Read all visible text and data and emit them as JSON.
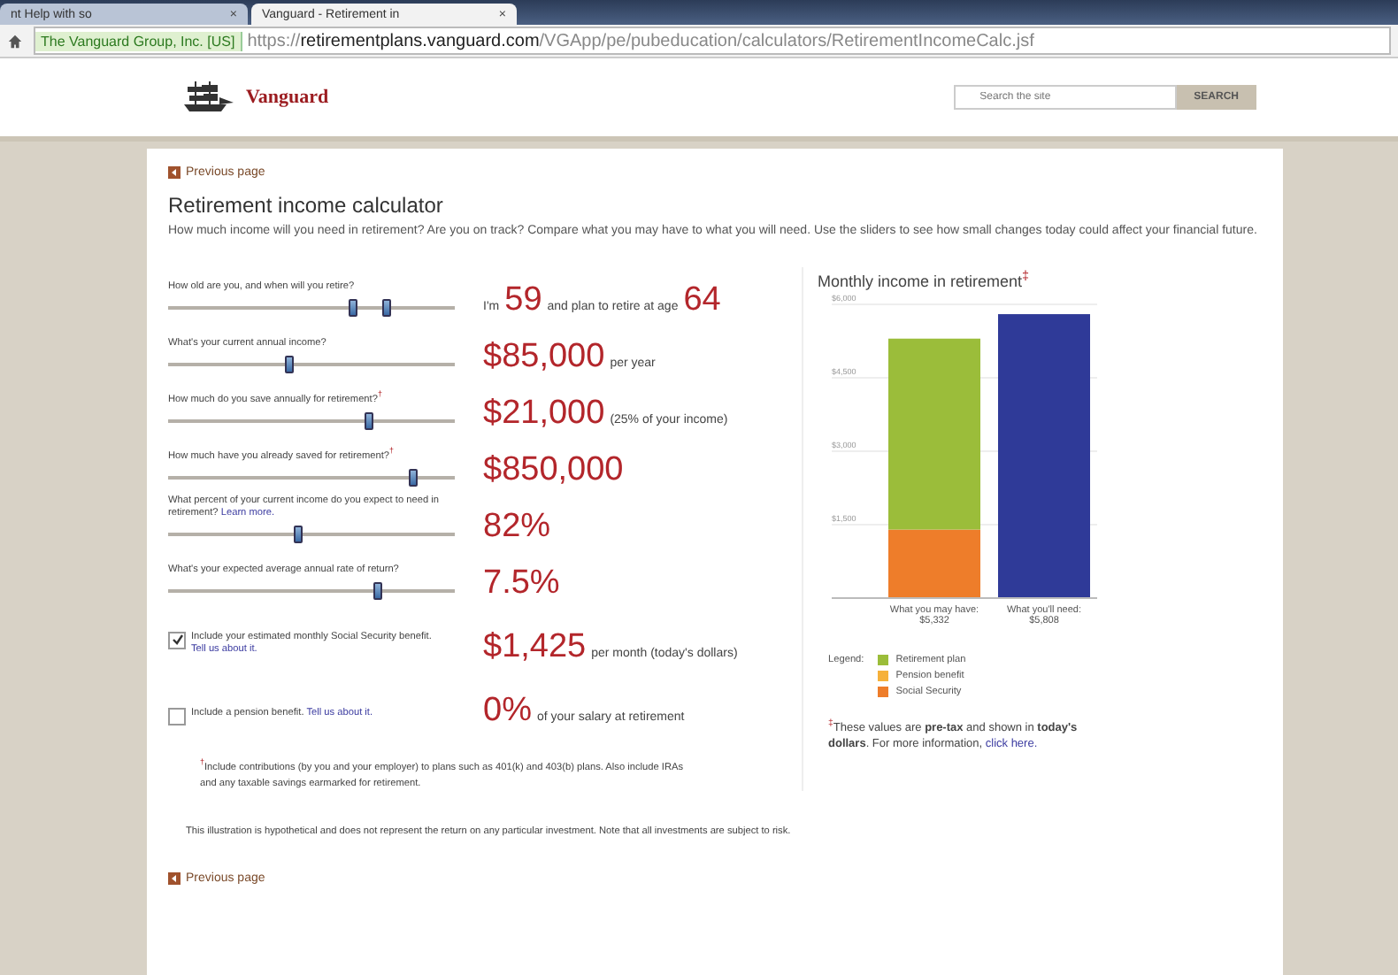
{
  "browser": {
    "tabs": [
      {
        "title": "nt Help with so",
        "close": "×",
        "selected": false
      },
      {
        "title": "Vanguard - Retirement in",
        "close": "×",
        "selected": true
      }
    ],
    "site_badge": "The Vanguard Group, Inc. [US]",
    "url_scheme": "https://",
    "url_host": "retirementplans.vanguard.com",
    "url_path": "/VGApp/pe/pubeducation/calculators/RetirementIncomeCalc.jsf"
  },
  "header": {
    "logo": "Vanguard",
    "search": {
      "placeholder": "Search the site"
    },
    "search_button": "SEARCH"
  },
  "previous_page_top": "Previous page",
  "title": "Retirement income calculator",
  "intro": "How much income will you need in retirement? Are you on track? Compare what you may have to what you will need. Use the sliders to see how small changes today could affect your financial future.",
  "questions": [
    {
      "kind": "slider",
      "label": "How old are you, and when will you retire?",
      "thumbs": [
        {
          "level": 0.64
        },
        {
          "level": 0.76
        }
      ],
      "reading": [
        {
          "text": "I'm",
          "big": false
        },
        {
          "text": "59",
          "big": true
        },
        {
          "text": "and plan to retire at age",
          "big": false
        },
        {
          "text": "64",
          "big": true
        }
      ]
    },
    {
      "kind": "slider",
      "label": "What's your current annual income?",
      "thumbs": [
        {
          "level": 0.42
        }
      ],
      "reading": [
        {
          "text": "$85,000",
          "big": true
        },
        {
          "text": "per year",
          "big": false
        }
      ]
    },
    {
      "kind": "slider",
      "label": "How much do you save annually for retirement?$^{†}$",
      "thumbs": [
        {
          "level": 0.7
        }
      ],
      "reading": [
        {
          "text": "$21,000",
          "big": true
        },
        {
          "text": "(25% of your income)",
          "big": false
        }
      ]
    },
    {
      "kind": "slider",
      "label": "How much have you already saved for retirement?$^{†}$",
      "thumbs": [
        {
          "level": 0.85
        }
      ],
      "reading": [
        {
          "text": "$850,000",
          "big": true
        }
      ]
    },
    {
      "kind": "slider",
      "label": "What percent of your current income do you expect to need in retirement?",
      "link": "Learn more.",
      "thumbs": [
        {
          "level": 0.45
        }
      ],
      "reading": [
        {
          "text": "82%",
          "big": true
        }
      ]
    },
    {
      "kind": "slider",
      "label": "What's your expected average annual rate of return?",
      "thumbs": [
        {
          "level": 0.73
        }
      ],
      "reading": [
        {
          "text": "7.5%",
          "big": true
        }
      ]
    },
    {
      "kind": "checkbox",
      "checked": true,
      "label": "Include your estimated monthly Social Security benefit.",
      "link": "Tell us about it.",
      "reading": [
        {
          "text": "$1,425",
          "big": true
        },
        {
          "text": "per month (today's dollars)",
          "big": false
        }
      ]
    },
    {
      "kind": "checkbox",
      "checked": false,
      "label": "Include a pension benefit.",
      "link": "Tell us about it.",
      "reading": [
        {
          "text": "0%",
          "big": true
        },
        {
          "text": "of your salary at retirement",
          "big": false
        }
      ]
    }
  ],
  "footnote": "$^{†}$Include contributions (by you and your employer) to plans such as 401(k) and 403(b) plans. Also include IRAs and any taxable savings earmarked for retirement.",
  "disclaimer": "This illustration is hypothetical and does not represent the return on any particular investment. Note that all investments are subject to risk.",
  "previous_page_bottom": "Previous page",
  "chart": {
    "chart_data": {
      "type": "bar",
      "title": "Monthly income in retirement$^{‡}$",
      "categories": [
        "What you may have: $5,332",
        "What you'll need: $5,808"
      ],
      "stacked": true,
      "grid": true,
      "ylim": [
        0,
        6000
      ],
      "yticks": [
        {
          "value": 1500,
          "label": "$1,500"
        },
        {
          "value": 3000,
          "label": "$3,000"
        },
        {
          "value": 4500,
          "label": "$4,500"
        },
        {
          "value": 6000,
          "label": "$6,000"
        }
      ],
      "series": [
        {
          "name": "Social Security",
          "color": "#ee7d2a",
          "values": [
            1400,
            null
          ]
        },
        {
          "name": "Pension benefit",
          "color": "#f6b13a",
          "values": [
            0,
            null
          ]
        },
        {
          "name": "Retirement plan",
          "color": "#9bbd3a",
          "values": [
            3900,
            null
          ]
        },
        {
          "color": "#2f3a98",
          "values": [
            null,
            5800
          ]
        }
      ]
    },
    "legend_label": "Legend:",
    "note": "$^{‡}$These values are **pre-tax** and shown in **today's dollars**. For more information,",
    "note_link": "click here."
  }
}
